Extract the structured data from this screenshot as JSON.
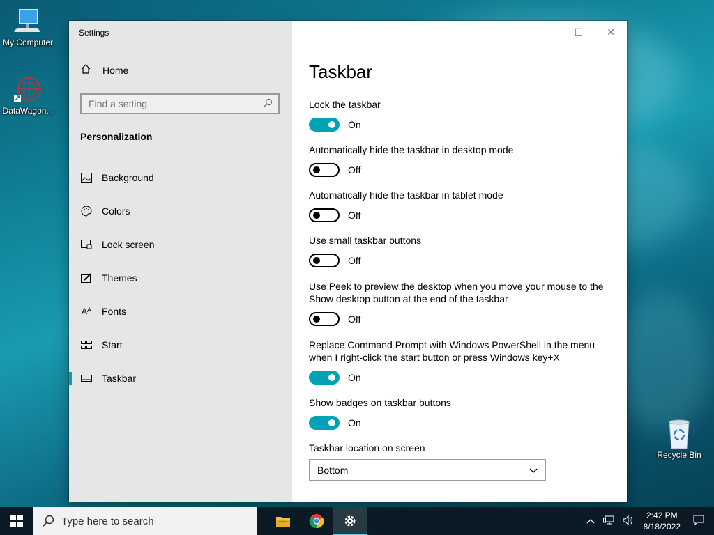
{
  "desktop": {
    "icons": [
      {
        "label": "My Computer",
        "icon": "computer-icon"
      },
      {
        "label": "DataWagon...",
        "icon": "datawagon-icon"
      },
      {
        "label": "Recycle Bin",
        "icon": "recycle-bin-icon"
      }
    ]
  },
  "window": {
    "title": "Settings",
    "controls": {
      "minimize": "—",
      "maximize": "☐",
      "close": "✕"
    }
  },
  "sidebar": {
    "home_label": "Home",
    "search_placeholder": "Find a setting",
    "section": "Personalization",
    "items": [
      {
        "label": "Background",
        "icon": "image-icon"
      },
      {
        "label": "Colors",
        "icon": "palette-icon"
      },
      {
        "label": "Lock screen",
        "icon": "lock-screen-icon"
      },
      {
        "label": "Themes",
        "icon": "brush-icon"
      },
      {
        "label": "Fonts",
        "icon": "font-icon"
      },
      {
        "label": "Start",
        "icon": "start-icon"
      },
      {
        "label": "Taskbar",
        "icon": "taskbar-icon",
        "selected": true
      }
    ]
  },
  "main": {
    "title": "Taskbar",
    "settings": [
      {
        "label": "Lock the taskbar",
        "state": "On"
      },
      {
        "label": "Automatically hide the taskbar in desktop mode",
        "state": "Off"
      },
      {
        "label": "Automatically hide the taskbar in tablet mode",
        "state": "Off"
      },
      {
        "label": "Use small taskbar buttons",
        "state": "Off"
      },
      {
        "label": "Use Peek to preview the desktop when you move your mouse to the Show desktop button at the end of the taskbar",
        "state": "Off"
      },
      {
        "label": "Replace Command Prompt with Windows PowerShell in the menu when I right-click the start button or press Windows key+X",
        "state": "On"
      },
      {
        "label": "Show badges on taskbar buttons",
        "state": "On"
      }
    ],
    "location_label": "Taskbar location on screen",
    "location_value": "Bottom"
  },
  "taskbar": {
    "search_placeholder": "Type here to search",
    "time": "2:42 PM",
    "date": "8/18/2022"
  },
  "colors": {
    "accent": "#00a3b4"
  }
}
